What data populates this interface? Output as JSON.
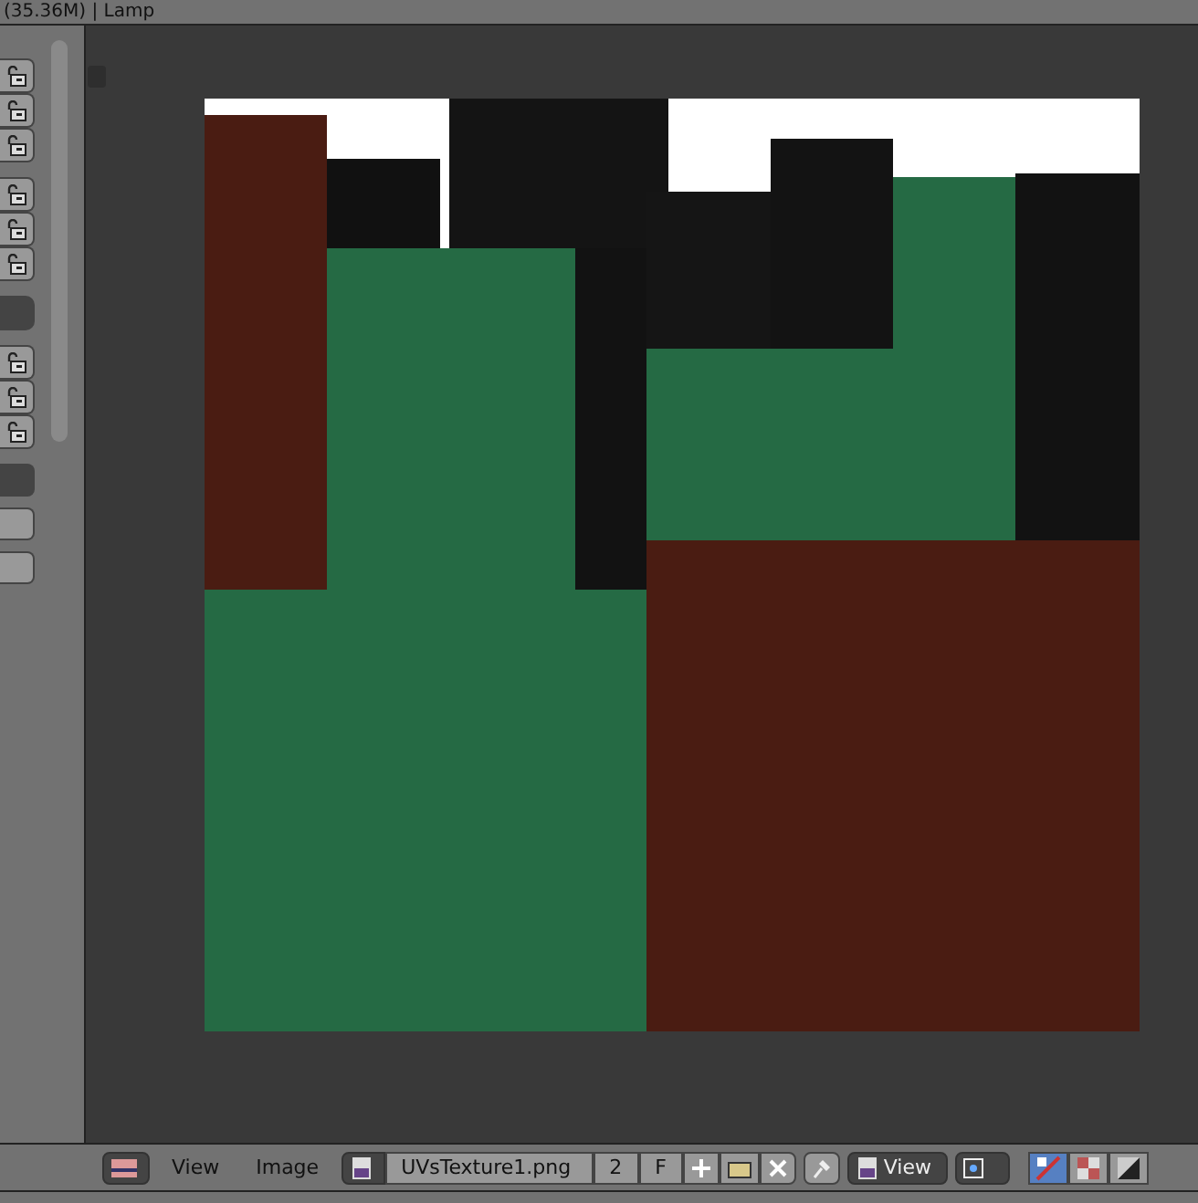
{
  "title_bar": {
    "text": "(35.36M) | Lamp"
  },
  "header": {
    "menus": [
      "View",
      "Image"
    ],
    "image_name": "UVsTexture1.png",
    "users": "2",
    "fake_user": "F",
    "display": "View",
    "toggles": [
      {
        "kind": "uv",
        "selected": true
      },
      {
        "kind": "checker",
        "selected": false
      },
      {
        "kind": "alpha",
        "selected": false
      }
    ]
  }
}
